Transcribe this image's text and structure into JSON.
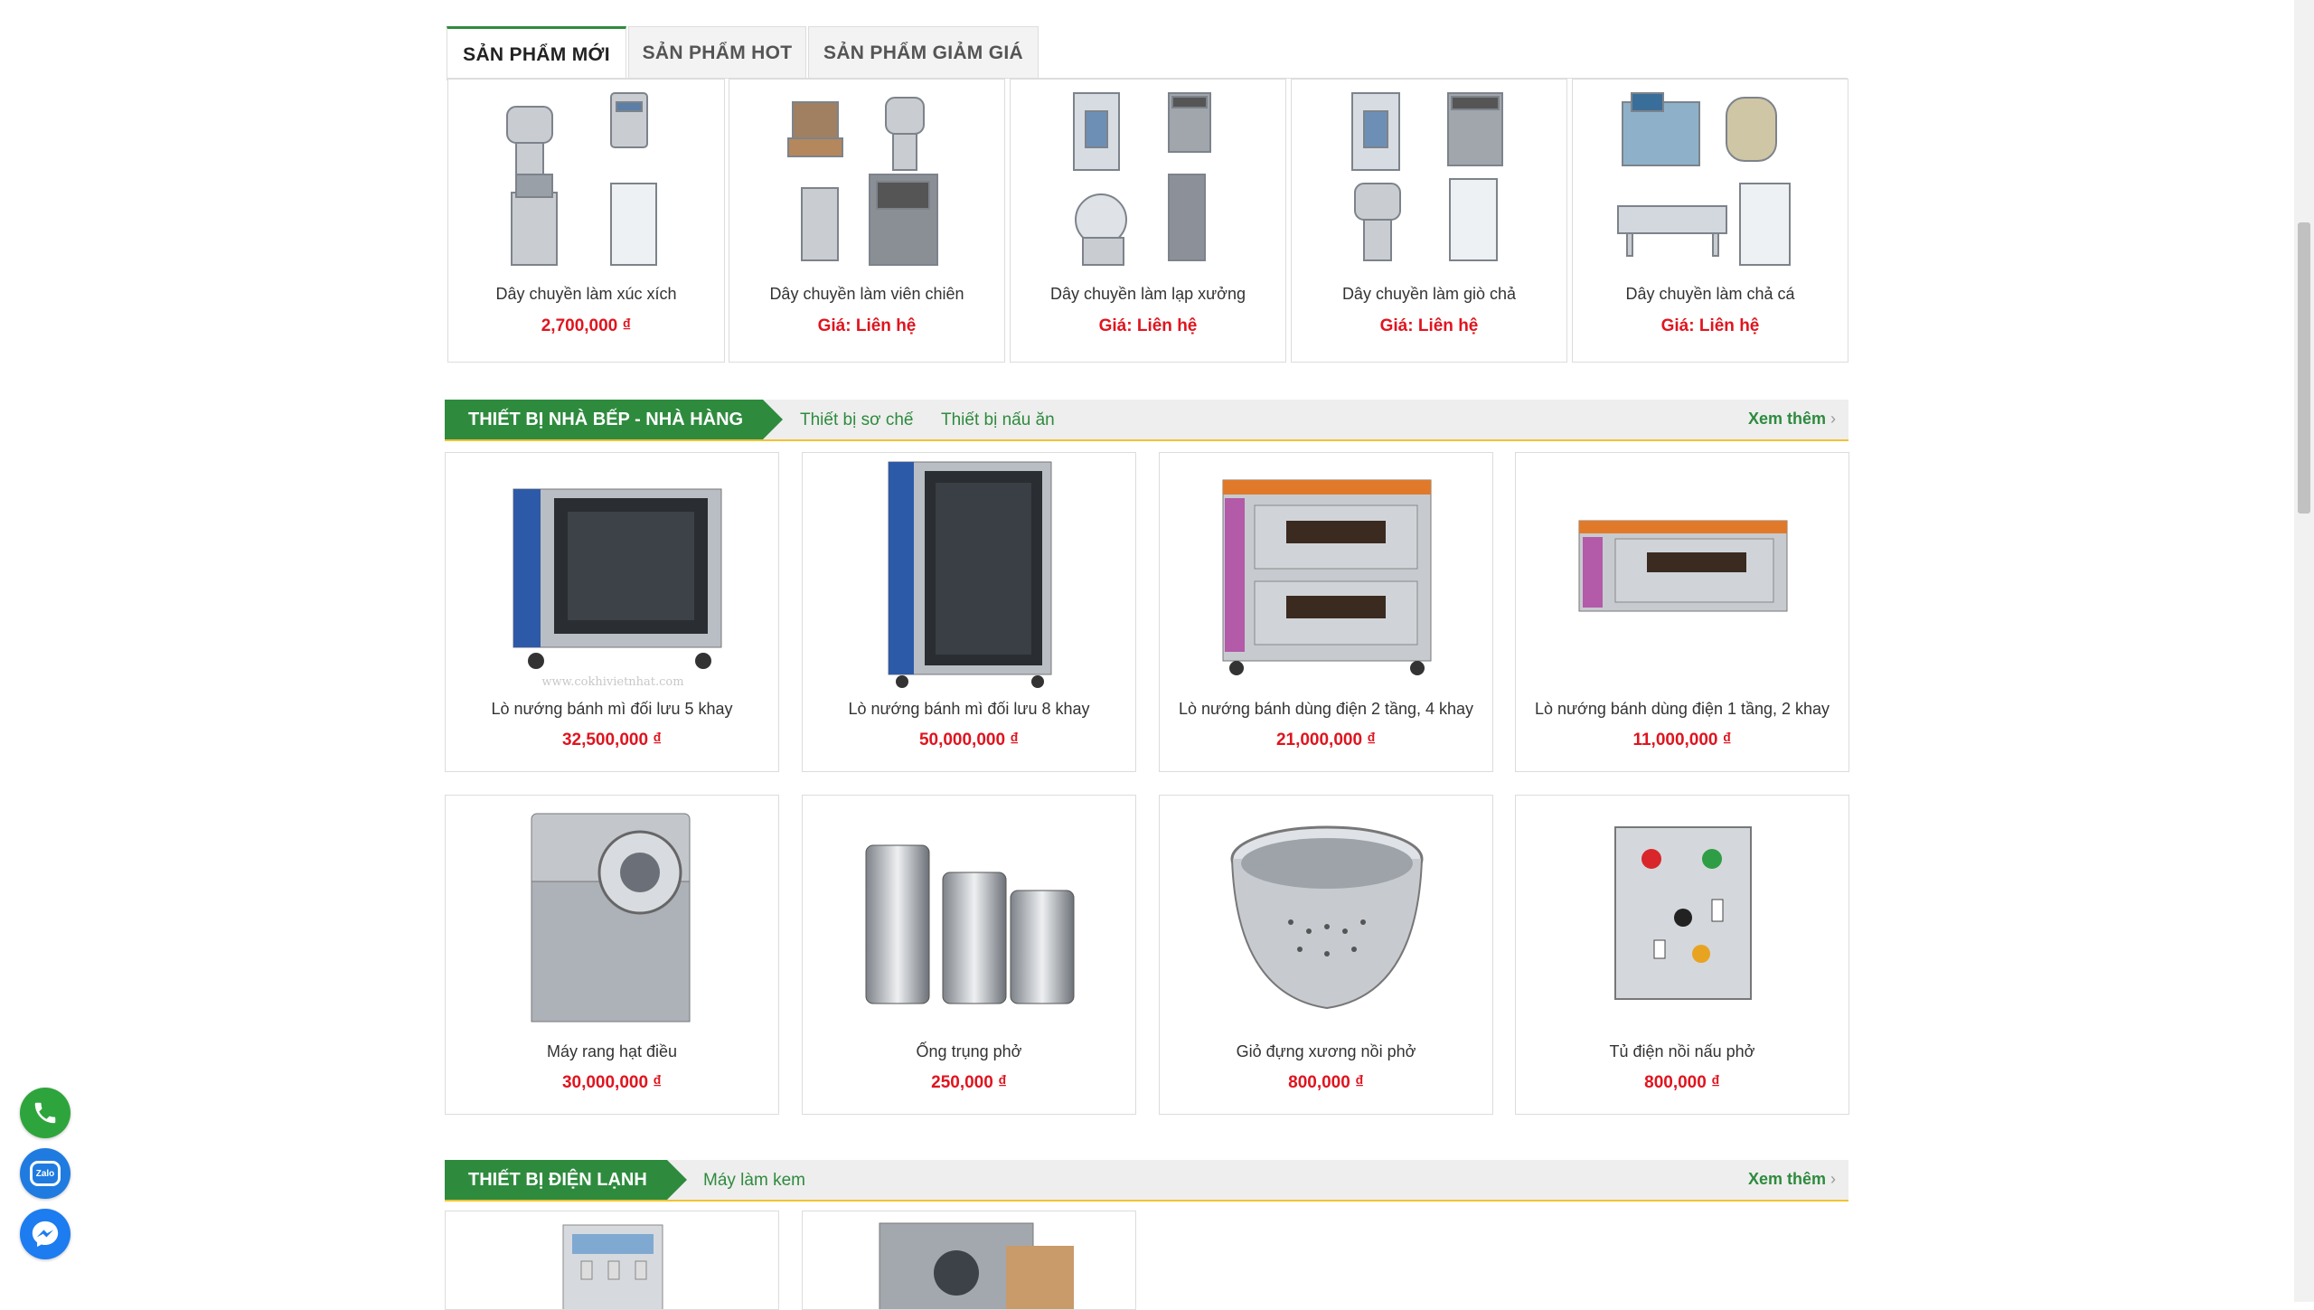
{
  "tabs": [
    {
      "label": "SẢN PHẨM MỚI"
    },
    {
      "label": "SẢN PHẨM HOT"
    },
    {
      "label": "SẢN PHẨM GIẢM GIÁ"
    }
  ],
  "new_products": [
    {
      "name": "Dây chuyền làm xúc xích",
      "price": "2,700,000 ₫"
    },
    {
      "name": "Dây chuyền làm viên chiên",
      "price": "Giá: Liên hệ"
    },
    {
      "name": "Dây chuyền làm lạp xưởng",
      "price": "Giá: Liên hệ"
    },
    {
      "name": "Dây chuyền làm giò chả",
      "price": "Giá: Liên hệ"
    },
    {
      "name": "Dây chuyền làm chả cá",
      "price": "Giá: Liên hệ"
    }
  ],
  "kitchen": {
    "title": "THIẾT BỊ NHÀ BẾP - NHÀ HÀNG",
    "links": [
      "Thiết bị sơ chế",
      "Thiết bị nấu ăn"
    ],
    "more": "Xem thêm",
    "watermark": "www.cokhivietnhat.com",
    "products": [
      {
        "name": "Lò nướng bánh mì đối lưu 5 khay",
        "price": "32,500,000 ₫"
      },
      {
        "name": "Lò nướng bánh mì đối lưu 8 khay",
        "price": "50,000,000 ₫"
      },
      {
        "name": "Lò nướng bánh dùng điện 2 tầng, 4 khay",
        "price": "21,000,000 ₫"
      },
      {
        "name": "Lò nướng bánh dùng điện 1 tầng, 2 khay",
        "price": "11,000,000 ₫"
      },
      {
        "name": "Máy rang hạt điều",
        "price": "30,000,000 ₫"
      },
      {
        "name": "Ống trụng phở",
        "price": "250,000 ₫"
      },
      {
        "name": "Giỏ đựng xương nồi phở",
        "price": "800,000 ₫"
      },
      {
        "name": "Tủ điện nồi nấu phở",
        "price": "800,000 ₫"
      }
    ]
  },
  "cooling": {
    "title": "THIẾT BỊ ĐIỆN LẠNH",
    "links": [
      "Máy làm kem"
    ],
    "more": "Xem thêm"
  },
  "contact": {
    "phone_icon": "phone-icon",
    "zalo_label": "Zalo",
    "messenger_icon": "messenger-icon"
  },
  "colors": {
    "brand_green": "#2e8b3e",
    "price_red": "#e0141e",
    "accent_yellow": "#f2c230"
  }
}
